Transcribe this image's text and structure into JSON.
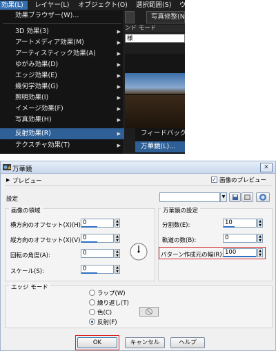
{
  "menubar": {
    "items": [
      "効果(L)",
      "レイヤー(L)",
      "オブジェクト(O)",
      "選択範囲(S)",
      "ウ"
    ]
  },
  "effects_menu": {
    "items": [
      "効果ブラウザー(W)...",
      "3D 効果(3)",
      "アートメディア効果(M)",
      "アーティスティック効果(A)",
      "ゆがみ効果(D)",
      "エッジ効果(E)",
      "幾何学効果(G)",
      "照明効果(I)",
      "イメージ効果(F)",
      "写真効果(H)",
      "反射効果(R)",
      "テクスチャ効果(T)"
    ]
  },
  "background_panel": {
    "photo_button": "写真修整(N)",
    "blend_mode_label": "ンド モード",
    "blend_mode_value": "様"
  },
  "submenu": {
    "items": [
      "フィードバック",
      "万華鏡(L)..."
    ]
  },
  "dialog": {
    "title": "万華鏡",
    "close_label": "✕",
    "preview_label": "プレビュー",
    "image_preview_label": "画像のプレビュー",
    "image_preview_checked": true,
    "preset_label": "設定",
    "preset_value": "",
    "image_region": {
      "title": "画像の領域",
      "fields": [
        {
          "label": "横方向のオフセット(X)(H):",
          "value": "0",
          "fill": 0.5
        },
        {
          "label": "縦方向のオフセット(X)(V):",
          "value": "0",
          "fill": 0.5
        },
        {
          "label": "回転の角度(A):",
          "value": "0",
          "fill": 0.0
        },
        {
          "label": "スケール(S):",
          "value": "0",
          "fill": 0.5
        }
      ]
    },
    "kaleido_settings": {
      "title": "万華鏡の設定",
      "fields": [
        {
          "label": "分割数(E):",
          "value": "10",
          "fill": 0.35
        },
        {
          "label": "軌道の数(B):",
          "value": "0",
          "fill": 0.0
        },
        {
          "label": "パターン作成元の幅(R):",
          "value": "100",
          "fill": 1.0
        }
      ]
    },
    "edge_mode": {
      "title": "エッジ モード",
      "options": [
        {
          "label": "ラップ(W)",
          "selected": false
        },
        {
          "label": "繰り返し(T)",
          "selected": false
        },
        {
          "label": "色(C)",
          "selected": false
        },
        {
          "label": "反射(F)",
          "selected": true
        }
      ]
    },
    "buttons": {
      "ok": "OK",
      "cancel": "キャンセル",
      "help": "ヘルプ"
    },
    "accent_color": "#2c6fc2",
    "highlight_color": "#d82020"
  }
}
